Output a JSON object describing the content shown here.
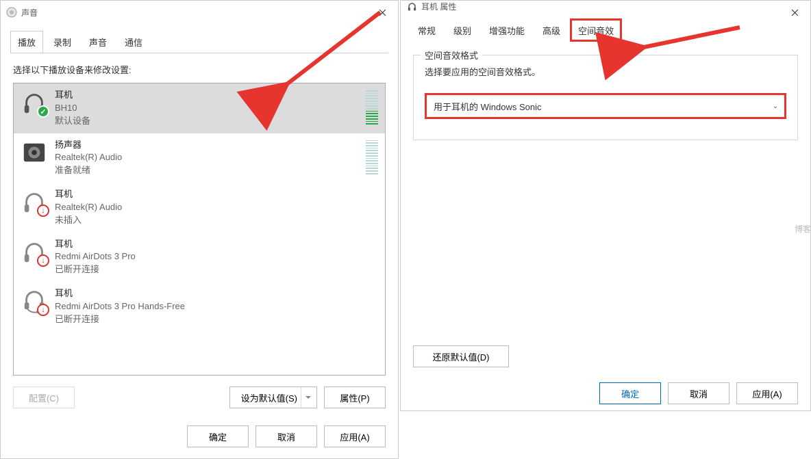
{
  "left_window": {
    "title": "声音",
    "tabs": [
      "播放",
      "录制",
      "声音",
      "通信"
    ],
    "active_tab": 0,
    "instruction": "选择以下播放设备来修改设置:",
    "devices": [
      {
        "type": "headphones",
        "title": "耳机",
        "sub": "BH10",
        "status": "默认设备",
        "badge": "ok",
        "selected": true,
        "levels": "active"
      },
      {
        "type": "speaker",
        "title": "扬声器",
        "sub": "Realtek(R) Audio",
        "status": "准备就绪",
        "badge": "",
        "selected": false,
        "levels": "idle"
      },
      {
        "type": "headphones",
        "title": "耳机",
        "sub": "Realtek(R) Audio",
        "status": "未插入",
        "badge": "down",
        "selected": false,
        "levels": ""
      },
      {
        "type": "headphones",
        "title": "耳机",
        "sub": "Redmi AirDots 3 Pro",
        "status": "已断开连接",
        "badge": "down",
        "selected": false,
        "levels": ""
      },
      {
        "type": "headset",
        "title": "耳机",
        "sub": "Redmi AirDots 3 Pro Hands-Free",
        "status": "已断开连接",
        "badge": "down",
        "selected": false,
        "levels": ""
      }
    ],
    "buttons": {
      "configure": "配置(C)",
      "set_default": "设为默认值(S)",
      "properties": "属性(P)"
    },
    "bottom": {
      "ok": "确定",
      "cancel": "取消",
      "apply": "应用(A)"
    }
  },
  "right_window": {
    "title": "耳机 属性",
    "tabs": [
      "常规",
      "级别",
      "增强功能",
      "高级",
      "空间音效"
    ],
    "active_tab": 4,
    "group_label": "空间音效格式",
    "group_instruction": "选择要应用的空间音效格式。",
    "select_value": "用于耳机的 Windows Sonic",
    "restore_defaults": "还原默认值(D)",
    "bottom": {
      "ok": "确定",
      "cancel": "取消",
      "apply": "应用(A)"
    }
  },
  "watermark": "博客"
}
